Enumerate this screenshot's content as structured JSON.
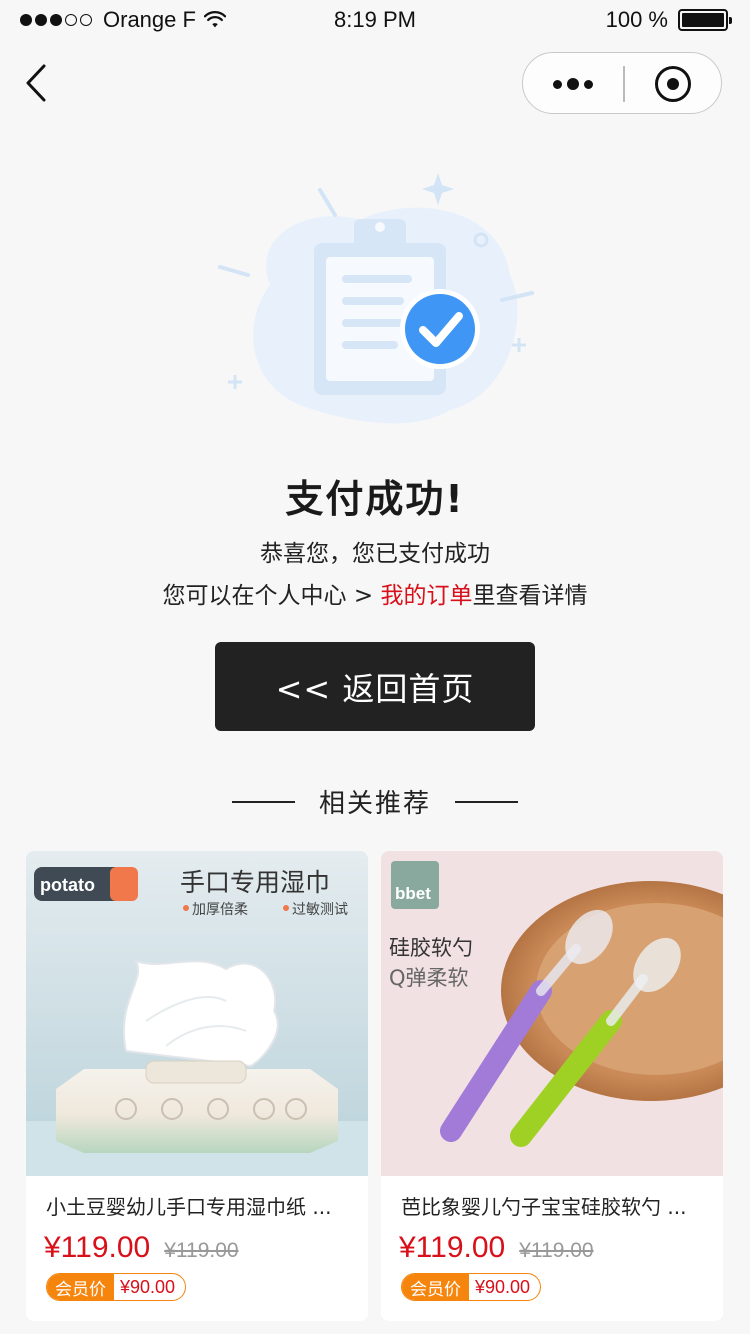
{
  "status_bar": {
    "carrier": "Orange F",
    "time": "8:19 PM",
    "battery": "100 %"
  },
  "nav": {
    "back_icon": "chevron-left-icon",
    "more_icon": "more-dots-icon",
    "close_icon": "target-close-icon"
  },
  "result": {
    "icon": "clipboard-check-icon",
    "title": "支付成功!",
    "line1": "恭喜您，您已支付成功",
    "line2_prefix": "您可以在个人中心 > ",
    "line2_link": "我的订单",
    "line2_suffix": "里查看详情"
  },
  "home_button": {
    "label": "<< 返回首页"
  },
  "recommend": {
    "title": "相关推荐"
  },
  "products": [
    {
      "image_brand": "potato",
      "image_heading": "手口专用湿巾",
      "image_tag1": "加厚倍柔",
      "image_tag2": "过敏测试",
      "name": "小土豆婴幼儿手口专用湿巾纸 ...",
      "price": "¥119.00",
      "original_price": "¥119.00",
      "member_label": "会员价",
      "member_price": "¥90.00"
    },
    {
      "image_brand": "bbet",
      "image_heading": "硅胶软勺",
      "image_sub": "Q弹柔软",
      "name": "芭比象婴儿勺子宝宝硅胶软勺 ...",
      "price": "¥119.00",
      "original_price": "¥119.00",
      "member_label": "会员价",
      "member_price": "¥90.00"
    }
  ],
  "colors": {
    "accent_red": "#d8101a",
    "member_orange": "#f5850d",
    "button_dark": "#222222",
    "check_blue": "#3f96f5"
  }
}
